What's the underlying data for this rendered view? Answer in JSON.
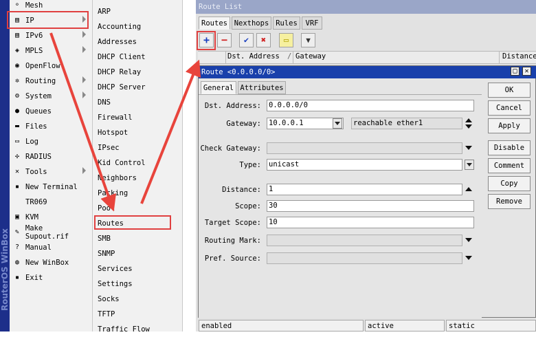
{
  "sidebar": {
    "brand": "RouterOS WinBox",
    "items": [
      {
        "label": "Mesh",
        "icon": "mesh-icon",
        "glyph": "⚬",
        "arrow": false
      },
      {
        "label": "IP",
        "icon": "ip-icon",
        "glyph": "▤",
        "arrow": true
      },
      {
        "label": "IPv6",
        "icon": "ipv6-icon",
        "glyph": "▤",
        "arrow": true
      },
      {
        "label": "MPLS",
        "icon": "mpls-icon",
        "glyph": "◈",
        "arrow": true
      },
      {
        "label": "OpenFlow",
        "icon": "openflow-icon",
        "glyph": "◉",
        "arrow": false
      },
      {
        "label": "Routing",
        "icon": "routing-icon",
        "glyph": "✲",
        "arrow": true
      },
      {
        "label": "System",
        "icon": "system-gear-icon",
        "glyph": "⚙",
        "arrow": true
      },
      {
        "label": "Queues",
        "icon": "queues-icon",
        "glyph": "●",
        "arrow": false
      },
      {
        "label": "Files",
        "icon": "files-icon",
        "glyph": "▬",
        "arrow": false
      },
      {
        "label": "Log",
        "icon": "log-icon",
        "glyph": "▭",
        "arrow": false
      },
      {
        "label": "RADIUS",
        "icon": "radius-icon",
        "glyph": "✣",
        "arrow": false
      },
      {
        "label": "Tools",
        "icon": "tools-icon",
        "glyph": "✕",
        "arrow": true
      },
      {
        "label": "New Terminal",
        "icon": "terminal-icon",
        "glyph": "▪",
        "arrow": false
      },
      {
        "label": "TR069",
        "icon": "",
        "glyph": "",
        "arrow": false
      },
      {
        "label": "KVM",
        "icon": "kvm-icon",
        "glyph": "▣",
        "arrow": false
      },
      {
        "label": "Make Supout.rif",
        "icon": "supout-icon",
        "glyph": "✎",
        "arrow": false
      },
      {
        "label": "Manual",
        "icon": "manual-help-icon",
        "glyph": "?",
        "arrow": false
      },
      {
        "label": "New WinBox",
        "icon": "winbox-icon",
        "glyph": "◍",
        "arrow": false
      },
      {
        "label": "Exit",
        "icon": "exit-icon",
        "glyph": "▪",
        "arrow": false
      }
    ]
  },
  "ip_submenu": {
    "items": [
      "ARP",
      "Accounting",
      "Addresses",
      "DHCP Client",
      "DHCP Relay",
      "DHCP Server",
      "DNS",
      "Firewall",
      "Hotspot",
      "IPsec",
      "Kid Control",
      "Neighbors",
      "Packing",
      "Pool",
      "Routes",
      "SMB",
      "SNMP",
      "Services",
      "Settings",
      "Socks",
      "TFTP",
      "Traffic Flow"
    ]
  },
  "route_list": {
    "title": "Route List",
    "tabs": [
      "Routes",
      "Nexthops",
      "Rules",
      "VRF"
    ],
    "toolbar": {
      "add": "+",
      "remove": "−",
      "enable": "✔",
      "disable": "✖",
      "comment": "▭",
      "filter": "▼"
    },
    "columns": [
      "Dst. Address",
      "Gateway",
      "Distance"
    ],
    "column_sort_marker": "/",
    "status": [
      "enabled",
      "active",
      "static"
    ]
  },
  "route_dialog": {
    "title": "Route <0.0.0.0/0>",
    "tabs": [
      "General",
      "Attributes"
    ],
    "fields": {
      "dst_address": {
        "label": "Dst. Address:",
        "value": "0.0.0.0/0"
      },
      "gateway": {
        "label": "Gateway:",
        "value": "10.0.0.1",
        "status": "reachable ether1"
      },
      "check_gateway": {
        "label": "Check Gateway:",
        "value": ""
      },
      "type": {
        "label": "Type:",
        "value": "unicast"
      },
      "distance": {
        "label": "Distance:",
        "value": "1"
      },
      "scope": {
        "label": "Scope:",
        "value": "30"
      },
      "target_scope": {
        "label": "Target Scope:",
        "value": "10"
      },
      "routing_mark": {
        "label": "Routing Mark:",
        "value": ""
      },
      "pref_source": {
        "label": "Pref. Source:",
        "value": ""
      }
    },
    "buttons": [
      "OK",
      "Cancel",
      "Apply",
      "Disable",
      "Comment",
      "Copy",
      "Remove"
    ],
    "window_buttons": {
      "maximize": "□",
      "close": "✕"
    }
  },
  "colors": {
    "highlight": "#e04040",
    "dialog_titlebar": "#1940ab",
    "brand_strip": "#1d2f8a"
  }
}
